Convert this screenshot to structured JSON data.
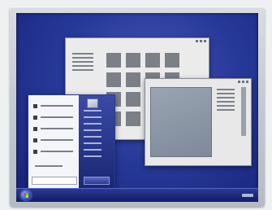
{
  "illustration": {
    "subject": "",
    "icons": {
      "monitor": "monitor-icon",
      "start_button": "windows-start-orb-icon",
      "windows": "window-icon",
      "start_menu": "start-menu-icon"
    },
    "colors": {
      "desktop": "#283a9a",
      "taskbar": "#101c66",
      "window_body": "#ebebeb",
      "bezel": "#c2c7cd",
      "start_menu_right_pane": "#2b378a"
    },
    "back_window_tile_count": 16,
    "start_menu_item_count": 5
  }
}
